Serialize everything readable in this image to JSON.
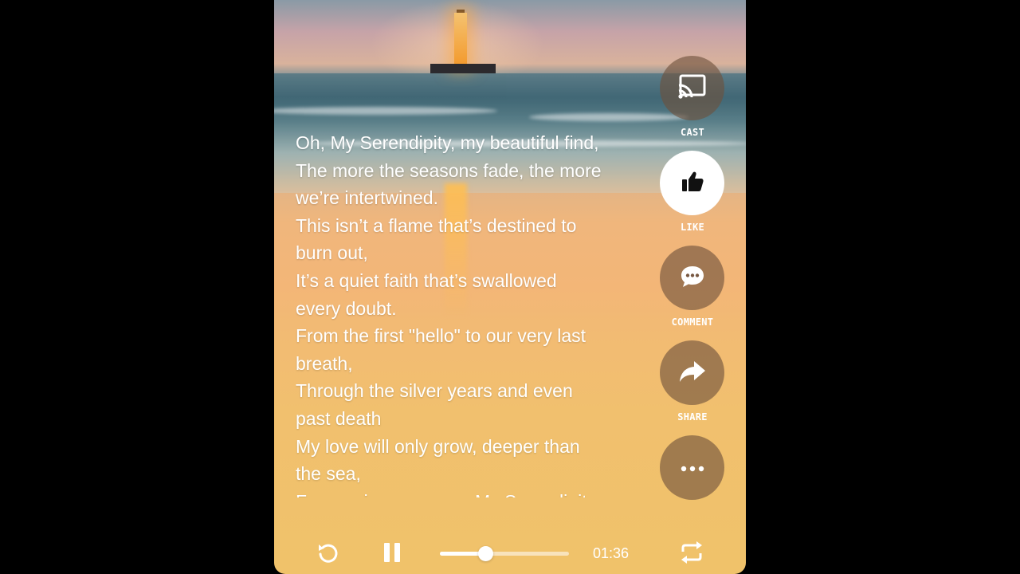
{
  "lyrics": [
    "Oh, My Serendipity, my beautiful find,",
    "The more the seasons fade, the more",
    "we’re intertwined.",
    "This isn’t a flame that’s destined to",
    "burn out,",
    "It’s a quiet faith that’s swallowed",
    "every doubt.",
    "From the first \"hello\" to our very last",
    "breath,",
    "Through the silver years and even",
    "past death",
    "My love will only grow, deeper than",
    "the sea,",
    "Forever in your arms, My Serendipity."
  ],
  "actions": {
    "cast": {
      "label": "CAST",
      "icon": "cast-icon"
    },
    "like": {
      "label": "LIKE",
      "icon": "thumbs-up-icon",
      "active": true
    },
    "comment": {
      "label": "COMMENT",
      "icon": "comment-icon"
    },
    "share": {
      "label": "SHARE",
      "icon": "share-icon"
    },
    "more": {
      "label": "",
      "icon": "more-icon"
    }
  },
  "player": {
    "time": "01:36",
    "progress": 0.35,
    "state": "playing",
    "icons": [
      "replay-icon",
      "pause-icon",
      "repeat-icon"
    ]
  }
}
